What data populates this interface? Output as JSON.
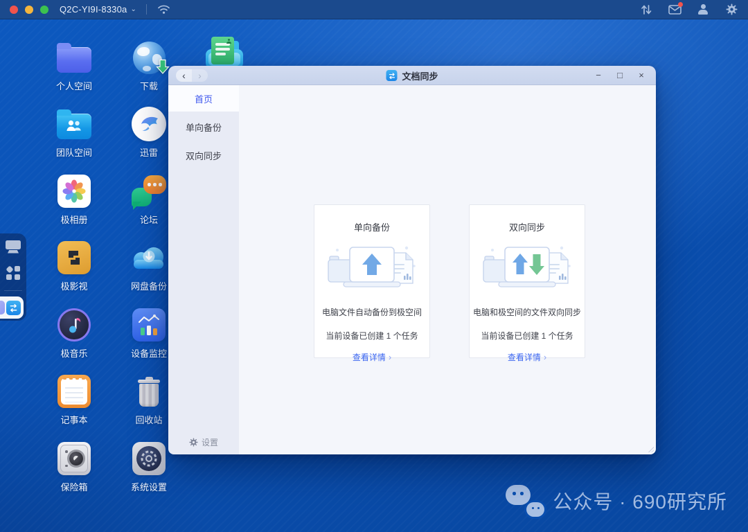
{
  "topbar": {
    "device_name": "Q2C-YI9I-8330a",
    "chevron": "⌄"
  },
  "desktop": {
    "col1": [
      {
        "label": "个人空间"
      },
      {
        "label": "团队空间"
      },
      {
        "label": "极相册"
      },
      {
        "label": "极影视"
      },
      {
        "label": "极音乐"
      },
      {
        "label": "记事本"
      },
      {
        "label": "保险箱"
      }
    ],
    "col2": [
      {
        "label": "下载"
      },
      {
        "label": "迅雷"
      },
      {
        "label": "论坛"
      },
      {
        "label": "网盘备份"
      },
      {
        "label": "设备监控"
      },
      {
        "label": "回收站"
      },
      {
        "label": "系统设置"
      }
    ]
  },
  "window": {
    "title": "文档同步",
    "nav": {
      "back": "‹",
      "forward": "›"
    },
    "controls": {
      "minimize": "−",
      "maximize": "□",
      "close": "×"
    },
    "sidebar": {
      "home": "首页",
      "one_way": "单向备份",
      "two_way": "双向同步",
      "settings": "设置"
    },
    "cards": [
      {
        "title": "单向备份",
        "description": "电脑文件自动备份到极空间",
        "task_info": "当前设备已创建 1 个任务",
        "link": "查看详情",
        "link_arrow": "›"
      },
      {
        "title": "双向同步",
        "description": "电脑和极空间的文件双向同步",
        "task_info": "当前设备已创建 1 个任务",
        "link": "查看详情",
        "link_arrow": "›"
      }
    ]
  },
  "watermark": {
    "text": "公众号 · 690研究所"
  },
  "colors": {
    "accent": "#3d56ee",
    "link": "#3b66f0",
    "topbar": "#1b4a8d",
    "desktop": "#0a50b2"
  }
}
